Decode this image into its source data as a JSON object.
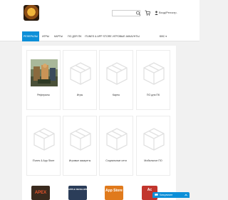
{
  "header": {
    "account_label": "Вход/Регистр.",
    "search_placeholder": ""
  },
  "nav": {
    "items": [
      {
        "label": "Рефералы",
        "active": true
      },
      {
        "label": "Игры"
      },
      {
        "label": "Карты"
      },
      {
        "label": "ПО для ПК"
      },
      {
        "label": "iTunes & App Store"
      },
      {
        "label": "Игровые аккаунты"
      }
    ],
    "right_label": "БВС"
  },
  "categories": [
    {
      "label": "Рефералы"
    },
    {
      "label": "Игры"
    },
    {
      "label": "Карты"
    },
    {
      "label": "ПО для ПК"
    },
    {
      "label": "iTunes & App Store"
    },
    {
      "label": "Игровые аккаунты"
    },
    {
      "label": "Социальные сети"
    },
    {
      "label": "Мобильное ПО"
    }
  ],
  "bottom_tiles": [
    {
      "label": "APEX"
    },
    {
      "label": "APPLE DEVELOPER"
    },
    {
      "label": "App Store"
    },
    {
      "label": "Ac"
    }
  ],
  "chat": {
    "label": "Консультант"
  },
  "colors": {
    "accent": "#0c8fd8"
  }
}
